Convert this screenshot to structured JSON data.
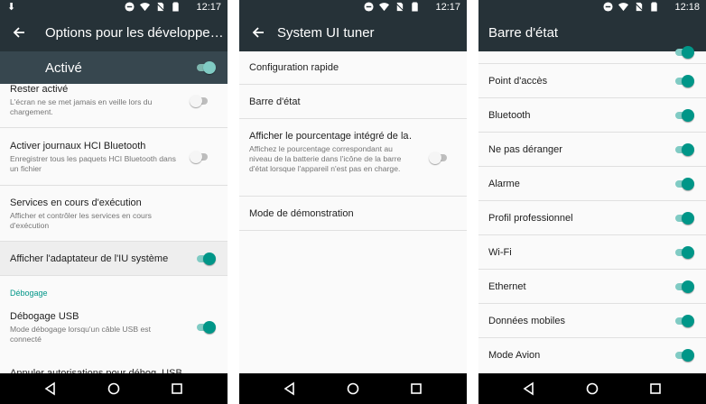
{
  "status": {
    "time1": "12:17",
    "time2": "12:17",
    "time3": "12:18"
  },
  "panel1": {
    "title": "Options pour les développe…",
    "master_label": "Activé",
    "items": [
      {
        "title": "Rester activé",
        "subtitle": "L'écran ne se met jamais en veille lors du chargement.",
        "toggle": "off"
      },
      {
        "title": "Activer journaux HCI Bluetooth",
        "subtitle": "Enregistrer tous les paquets HCI Bluetooth dans un fichier",
        "toggle": "off"
      },
      {
        "title": "Services en cours d'exécution",
        "subtitle": "Afficher et contrôler les services en cours d'exécution"
      },
      {
        "title": "Afficher l'adaptateur de l'IU système",
        "toggle": "on"
      }
    ],
    "section": "Débogage",
    "debug_items": [
      {
        "title": "Débogage USB",
        "subtitle": "Mode débogage lorsqu'un câble USB est connecté",
        "toggle": "on"
      },
      {
        "title": "Annuler autorisations pour débog. USB"
      }
    ]
  },
  "panel2": {
    "title": "System UI tuner",
    "items": [
      {
        "title": "Configuration rapide"
      },
      {
        "title": "Barre d'état"
      },
      {
        "title": "Afficher le pourcentage intégré de la…",
        "subtitle": "Affichez le pourcentage correspondant au niveau de la batterie dans l'icône de la barre d'état lorsque l'appareil n'est pas en charge.",
        "toggle": "off"
      },
      {
        "title": "Mode de démonstration"
      }
    ]
  },
  "panel3": {
    "title": "Barre d'état",
    "items": [
      {
        "title": "Point d'accès",
        "toggle": "on"
      },
      {
        "title": "Bluetooth",
        "toggle": "on"
      },
      {
        "title": "Ne pas déranger",
        "toggle": "on"
      },
      {
        "title": "Alarme",
        "toggle": "on"
      },
      {
        "title": "Profil professionnel",
        "toggle": "on"
      },
      {
        "title": "Wi-Fi",
        "toggle": "on"
      },
      {
        "title": "Ethernet",
        "toggle": "on"
      },
      {
        "title": "Données mobiles",
        "toggle": "on"
      },
      {
        "title": "Mode Avion",
        "toggle": "on"
      }
    ]
  },
  "colors": {
    "toolbar": "#263238",
    "master_bar": "#37474f",
    "accent": "#009688",
    "background": "#fafafa"
  }
}
